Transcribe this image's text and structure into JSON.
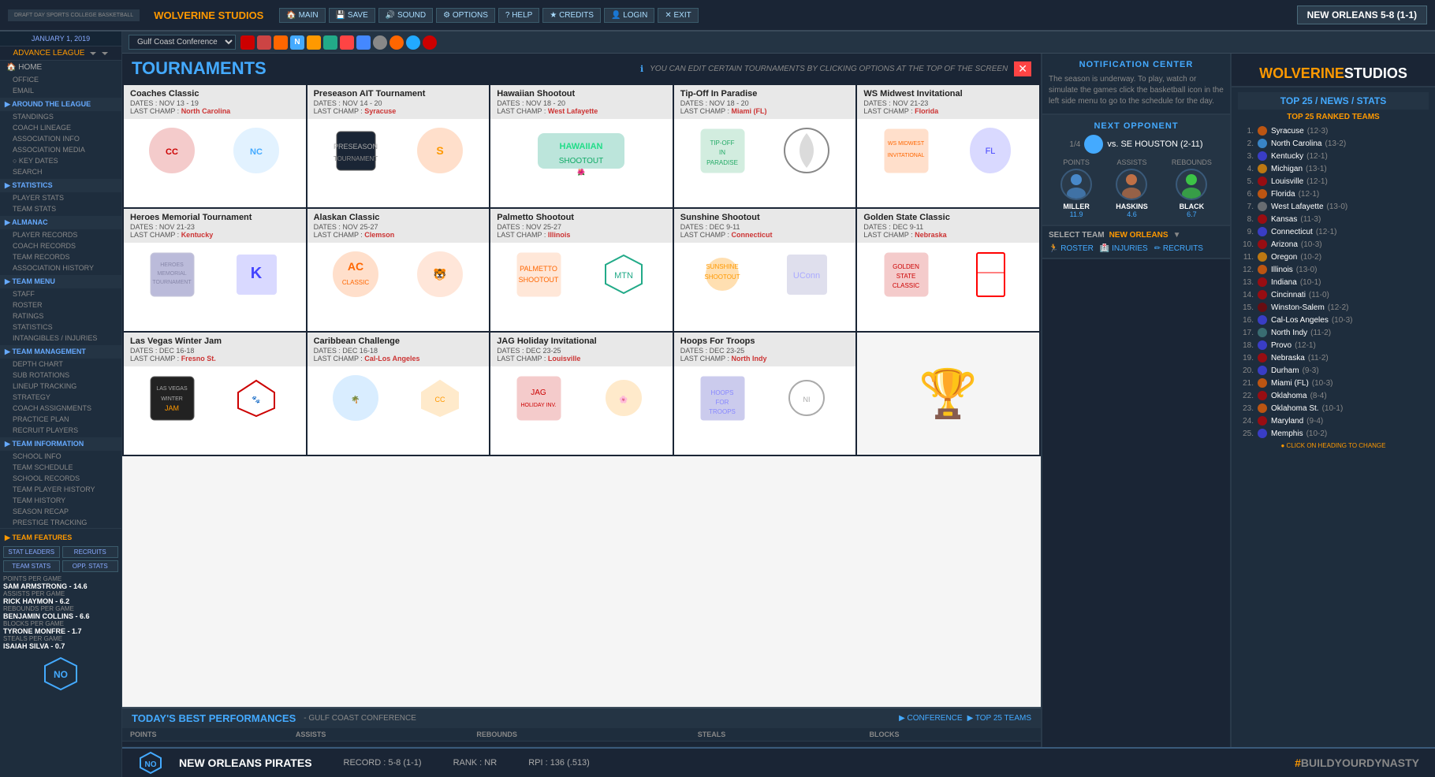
{
  "app": {
    "title": "DRAFT DAY SPORTS COLLEGE BASKETBALL",
    "brand": "WOLVERINE STUDIOS"
  },
  "top_nav": {
    "logo_dds": "DRAFT DAY SPORTS",
    "logo_cb": "COLLEGEBASKETBALL",
    "brand": "WOLVERINE STUDIOS",
    "team_record": "NEW ORLEANS 5-8 (1-1)",
    "menu_items": [
      {
        "label": "MAIN",
        "icon": "🏠"
      },
      {
        "label": "SAVE",
        "icon": "💾"
      },
      {
        "label": "SOUND",
        "icon": "🔊"
      },
      {
        "label": "OPTIONS",
        "icon": "⚙"
      },
      {
        "label": "HELP",
        "icon": "?"
      },
      {
        "label": "CREDITS",
        "icon": "★"
      },
      {
        "label": "LOGIN",
        "icon": "👤"
      },
      {
        "label": "EXIT",
        "icon": "✕"
      }
    ]
  },
  "second_nav": {
    "conference": "Gulf Coast Conference",
    "dropdown_placeholder": "Gulf Coast Conference"
  },
  "sidebar": {
    "date": "JANUARY 1, 2019",
    "league": "ADVANCE LEAGUE",
    "items": [
      {
        "label": "HOME",
        "icon": "🏠",
        "active": false
      },
      {
        "label": "OFFICE",
        "active": false
      },
      {
        "label": "EMAIL",
        "active": false
      }
    ],
    "sections": [
      {
        "header": "AROUND THE LEAGUE",
        "items": [
          "STANDINGS",
          "COACH LINEAGE",
          "ASSOCIATION INFO",
          "ASSOCIATION MEDIA",
          "KEY DATES",
          "SEARCH"
        ]
      },
      {
        "header": "STATISTICS",
        "items": [
          "PLAYER STATS",
          "TEAM STATS"
        ]
      },
      {
        "header": "ALMANAC",
        "items": [
          "PLAYER RECORDS",
          "COACH RECORDS",
          "TEAM RECORDS",
          "ASSOCIATION HISTORY"
        ]
      },
      {
        "header": "TEAM MENU",
        "items": [
          "STAFF",
          "ROSTER",
          "RATINGS",
          "STATISTICS",
          "INTANGIBLES / INJURIES"
        ]
      },
      {
        "header": "TEAM MANAGEMENT",
        "items": [
          "DEPTH CHART",
          "SUB ROTATIONS",
          "LINEUP TRACKING",
          "STRATEGY",
          "COACH ASSIGNMENTS",
          "PRACTICE PLAN",
          "RECRUIT PLAYERS"
        ]
      },
      {
        "header": "TEAM INFORMATION",
        "items": [
          "SCHOOL INFO",
          "TEAM SCHEDULE",
          "SCHOOL RECORDS",
          "TEAM PLAYER HISTORY",
          "TEAM HISTORY",
          "SEASON RECAP",
          "PRESTIGE TRACKING"
        ]
      }
    ],
    "team_features": {
      "header": "TEAM FEATURES",
      "buttons": [
        "STAT LEADERS",
        "RECRUITS"
      ],
      "buttons2": [
        "TEAM STATS",
        "OPP. STATS"
      ],
      "stats": [
        {
          "label": "POINTS PER GAME",
          "player": "SAM ARMSTRONG",
          "value": "14.6"
        },
        {
          "label": "ASSISTS PER GAME",
          "player": "RICK HAYMON",
          "value": "6.2"
        },
        {
          "label": "REBOUNDS PER GAME",
          "player": "BENJAMIN COLLINS",
          "value": "6.6"
        },
        {
          "label": "BLOCKS PER GAME",
          "player": "TYRONE MONFRE",
          "value": "1.7"
        },
        {
          "label": "STEALS PER GAME",
          "player": "ISAIAH SILVA",
          "value": "0.7"
        }
      ]
    }
  },
  "tournaments": {
    "title": "TOURNAMENTS",
    "info": "YOU CAN EDIT CERTAIN TOURNAMENTS BY CLICKING OPTIONS AT THE TOP OF THE SCREEN",
    "cards": [
      {
        "name": "Coaches Classic",
        "dates": "DATES : NOV 13 - 19",
        "last_champ_label": "LAST CHAMP :",
        "last_champ": "North Carolina",
        "logo1_color": "#c00",
        "logo2_color": "#4488cc"
      },
      {
        "name": "Preseason AIT Tournament",
        "dates": "DATES : NOV 14 - 20",
        "last_champ_label": "LAST CHAMP :",
        "last_champ": "Syracuse",
        "logo1_color": "#f60",
        "logo2_color": "#f90"
      },
      {
        "name": "Hawaiian Shootout",
        "dates": "DATES : NOV 18 - 20",
        "last_champ_label": "LAST CHAMP :",
        "last_champ": "West Lafayette",
        "logo1_color": "#2a8",
        "logo2_color": "#5af"
      },
      {
        "name": "Tip-Off In Paradise",
        "dates": "DATES : NOV 18 - 20",
        "last_champ_label": "LAST CHAMP :",
        "last_champ": "Miami (FL)",
        "logo1_color": "#2a6",
        "logo2_color": "#4af"
      },
      {
        "name": "WS Midwest Invitational",
        "dates": "DATES : NOV 21-23",
        "last_champ_label": "LAST CHAMP :",
        "last_champ": "Florida",
        "logo1_color": "#f60",
        "logo2_color": "#44f"
      },
      {
        "name": "Heroes Memorial Tournament",
        "dates": "DATES : NOV 21-23",
        "last_champ_label": "LAST CHAMP :",
        "last_champ": "Kentucky",
        "logo1_color": "#228",
        "logo2_color": "#44f"
      },
      {
        "name": "Alaskan Classic",
        "dates": "DATES : NOV 25-27",
        "last_champ_label": "LAST CHAMP :",
        "last_champ": "Clemson",
        "logo1_color": "#f60",
        "logo2_color": "#f84"
      },
      {
        "name": "Palmetto Shootout",
        "dates": "DATES : NOV 25-27",
        "last_champ_label": "LAST CHAMP :",
        "last_champ": "Illinois",
        "logo1_color": "#f60",
        "logo2_color": "#2a8"
      },
      {
        "name": "Sunshine Shootout",
        "dates": "DATES : DEC 9-11",
        "last_champ_label": "LAST CHAMP :",
        "last_champ": "Connecticut",
        "logo1_color": "#f90",
        "logo2_color": "#66a"
      },
      {
        "name": "Golden State Classic",
        "dates": "DATES : DEC 9-11",
        "last_champ_label": "LAST CHAMP :",
        "last_champ": "Nebraska",
        "logo1_color": "#c00",
        "logo2_color": "#f00"
      },
      {
        "name": "Las Vegas Winter Jam",
        "dates": "DATES : DEC 16-18",
        "last_champ_label": "LAST CHAMP :",
        "last_champ": "Fresno St.",
        "logo1_color": "#222",
        "logo2_color": "#c00"
      },
      {
        "name": "Caribbean Challenge",
        "dates": "DATES : DEC 16-18",
        "last_champ_label": "LAST CHAMP :",
        "last_champ": "Cal-Los Angeles",
        "logo1_color": "#4af",
        "logo2_color": "#f90"
      },
      {
        "name": "JAG Holiday Invitational",
        "dates": "DATES : DEC 23-25",
        "last_champ_label": "LAST CHAMP :",
        "last_champ": "Louisville",
        "logo1_color": "#c00",
        "logo2_color": "#f90"
      },
      {
        "name": "Hoops For Troops",
        "dates": "DATES : DEC 23-25",
        "last_champ_label": "LAST CHAMP :",
        "last_champ": "North Indy",
        "logo1_color": "#00a",
        "logo2_color": "#aaa"
      },
      {
        "name": "",
        "dates": "",
        "last_champ_label": "",
        "last_champ": "",
        "is_trophy": true
      }
    ]
  },
  "best_performances": {
    "title": "TODAY'S BEST PERFORMANCES",
    "subtitle": "- GULF COAST CONFERENCE",
    "tabs": [
      "▶ CONFERENCE",
      "▶ TOP 25 TEAMS"
    ],
    "columns": [
      "POINTS",
      "ASSISTS",
      "REBOUNDS",
      "STEALS",
      "BLOCKS"
    ]
  },
  "notification_center": {
    "title": "NOTIFICATION CENTER",
    "text": "The season is underway. To play, watch or simulate the games click the basketball icon in the left side menu to go to the schedule for the day."
  },
  "next_opponent": {
    "title": "NEXT OPPONENT",
    "game_num": "1/4",
    "vs": "vs. SE HOUSTON (2-11)",
    "stats_labels": [
      "POINTS",
      "ASSISTS",
      "REBOUNDS"
    ],
    "players": [
      {
        "name": "MILLER",
        "value": "11.9"
      },
      {
        "name": "HASKINS",
        "value": "4.6"
      },
      {
        "name": "BLACK",
        "value": "6.7"
      }
    ]
  },
  "select_team": {
    "label": "SELECT TEAM",
    "team": "NEW ORLEANS",
    "links": [
      "ROSTER",
      "INJURIES",
      "RECRUITS"
    ]
  },
  "top25": {
    "section_title": "TOP 25 / NEWS / STATS",
    "title": "TOP 25 RANKED TEAMS",
    "click_hint": "● CLICK ON HEADING TO CHANGE",
    "teams": [
      {
        "rank": "1.",
        "name": "Syracuse",
        "record": "(12-3)",
        "color": "#f60"
      },
      {
        "rank": "2.",
        "name": "North Carolina",
        "record": "(13-2)",
        "color": "#4af"
      },
      {
        "rank": "3.",
        "name": "Kentucky",
        "record": "(12-1)",
        "color": "#44f"
      },
      {
        "rank": "4.",
        "name": "Michigan",
        "record": "(13-1)",
        "color": "#f90"
      },
      {
        "rank": "5.",
        "name": "Louisville",
        "record": "(12-1)",
        "color": "#c00"
      },
      {
        "rank": "6.",
        "name": "Florida",
        "record": "(12-1)",
        "color": "#f60"
      },
      {
        "rank": "7.",
        "name": "West Lafayette",
        "record": "(13-0)",
        "color": "#888"
      },
      {
        "rank": "8.",
        "name": "Kansas",
        "record": "(11-3)",
        "color": "#c00"
      },
      {
        "rank": "9.",
        "name": "Connecticut",
        "record": "(12-1)",
        "color": "#44f"
      },
      {
        "rank": "10.",
        "name": "Arizona",
        "record": "(10-3)",
        "color": "#c00"
      },
      {
        "rank": "11.",
        "name": "Oregon",
        "record": "(10-2)",
        "color": "#f90"
      },
      {
        "rank": "12.",
        "name": "Illinois",
        "record": "(13-0)",
        "color": "#f60"
      },
      {
        "rank": "13.",
        "name": "Indiana",
        "record": "(10-1)",
        "color": "#c00"
      },
      {
        "rank": "14.",
        "name": "Cincinnati",
        "record": "(11-0)",
        "color": "#c00"
      },
      {
        "rank": "15.",
        "name": "Winston-Salem",
        "record": "(12-2)",
        "color": "#800"
      },
      {
        "rank": "16.",
        "name": "Cal-Los Angeles",
        "record": "(10-3)",
        "color": "#44f"
      },
      {
        "rank": "17.",
        "name": "North Indy",
        "record": "(11-2)",
        "color": "#488"
      },
      {
        "rank": "18.",
        "name": "Provo",
        "record": "(12-1)",
        "color": "#44f"
      },
      {
        "rank": "19.",
        "name": "Nebraska",
        "record": "(11-2)",
        "color": "#c00"
      },
      {
        "rank": "20.",
        "name": "Durham",
        "record": "(9-3)",
        "color": "#44f"
      },
      {
        "rank": "21.",
        "name": "Miami (FL)",
        "record": "(10-3)",
        "color": "#f60"
      },
      {
        "rank": "22.",
        "name": "Oklahoma",
        "record": "(8-4)",
        "color": "#c00"
      },
      {
        "rank": "23.",
        "name": "Oklahoma St.",
        "record": "(10-1)",
        "color": "#f60"
      },
      {
        "rank": "24.",
        "name": "Maryland",
        "record": "(9-4)",
        "color": "#c00"
      },
      {
        "rank": "25.",
        "name": "Memphis",
        "record": "(10-2)",
        "color": "#44f"
      }
    ]
  },
  "bottom_bar": {
    "team_name": "NEW ORLEANS PIRATES",
    "record": "RECORD : 5-8 (1-1)",
    "rank": "RANK : NR",
    "rpi": "RPI : 136 (.513)",
    "hashtag": "#BUILDYOURDYNASTY"
  }
}
